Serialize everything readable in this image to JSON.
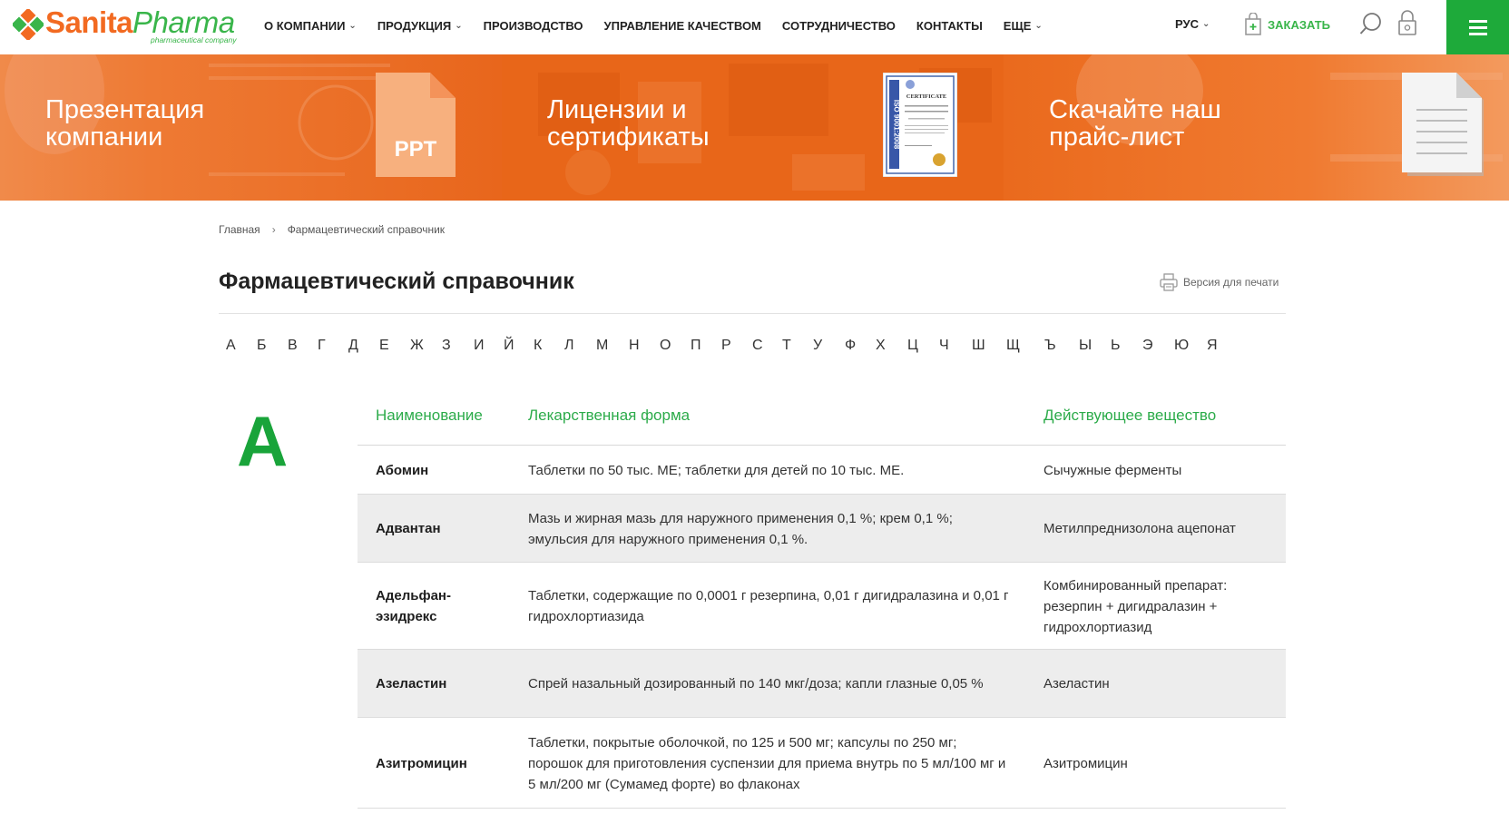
{
  "header": {
    "logo": {
      "brand_part1": "Sanita",
      "brand_part2": "Pharma",
      "tagline": "pharmaceutical company"
    },
    "nav": [
      {
        "label": "О КОМПАНИИ",
        "has_dropdown": true
      },
      {
        "label": "ПРОДУКЦИЯ",
        "has_dropdown": true
      },
      {
        "label": "ПРОИЗВОДСТВО",
        "has_dropdown": false
      },
      {
        "label": "УПРАВЛЕНИЕ КАЧЕСТВОМ",
        "has_dropdown": false
      },
      {
        "label": "СОТРУДНИЧЕСТВО",
        "has_dropdown": false
      },
      {
        "label": "КОНТАКТЫ",
        "has_dropdown": false
      },
      {
        "label": "ЕЩЕ",
        "has_dropdown": true
      }
    ],
    "language": "РУС",
    "order_label": "ЗАКАЗАТЬ",
    "icons": {
      "search": "search-icon",
      "lock": "lock-icon",
      "cart": "cart-icon",
      "menu": "hamburger-icon"
    }
  },
  "banners": [
    {
      "title": "Презентация\nкомпании",
      "icon": "ppt-file-icon",
      "icon_text": "PPT"
    },
    {
      "title": "Лицензии и\nсертификаты",
      "icon": "certificate-icon",
      "icon_text": "CERTIFICATE",
      "icon_side_text": "ISO 9001:2008"
    },
    {
      "title": "Скачайте наш\nпрайс-лист",
      "icon": "document-icon"
    }
  ],
  "breadcrumb": {
    "home": "Главная",
    "separator": "›",
    "current": "Фармацевтический справочник"
  },
  "page_title": "Фармацевтический справочник",
  "print_label": "Версия для печати",
  "alphabet": [
    "А",
    "Б",
    "В",
    "Г",
    "Д",
    "Е",
    "Ж",
    "З",
    "И",
    "Й",
    "К",
    "Л",
    "М",
    "Н",
    "О",
    "П",
    "Р",
    "С",
    "Т",
    "У",
    "Ф",
    "Х",
    "Ц",
    "Ч",
    "Ш",
    "Щ",
    "Ъ",
    "Ы",
    "Ь",
    "Э",
    "Ю",
    "Я"
  ],
  "section_letter": "А",
  "table": {
    "headers": {
      "name": "Наименование",
      "form": "Лекарственная форма",
      "substance": "Действующее вещество"
    },
    "rows": [
      {
        "name": "Абомин",
        "form": "Таблетки по 50 тыс. МЕ; таблетки для детей по 10 тыс. МЕ.",
        "substance": "Сычужные ферменты"
      },
      {
        "name": "Адвантан",
        "form": "Мазь и жирная мазь для наружного применения 0,1 %; крем 0,1 %; эмульсия для наружного применения 0,1 %.",
        "substance": "Метилпреднизолона ацепонат"
      },
      {
        "name": "Адельфан-эзидрекс",
        "form": "Таблетки, содержащие по 0,0001 г резерпина, 0,01 г дигидралазина и 0,01 г гидрохлортиазида",
        "substance": "Комбинированный препарат: резерпин + дигидралазин + гидрохлортиазид"
      },
      {
        "name": "Азеластин",
        "form": "Спрей назальный дозированный по 140 мкг/доза; капли глазные 0,05 %",
        "substance": "Азеластин"
      },
      {
        "name": "Азитромицин",
        "form": "Таблетки, покрытые оболочкой, по 125 и 500 мг; капсулы по 250 мг; порошок для приготовления суспензии для приема внутрь по 5 мл/100 мг и 5 мл/200 мг (Сумамед форте) во флаконах",
        "substance": "Азитромицин"
      }
    ]
  },
  "colors": {
    "brand_orange": "#f26a21",
    "brand_green": "#39b54a",
    "menu_green": "#1eaa3a",
    "header_green": "#2cab4a"
  }
}
